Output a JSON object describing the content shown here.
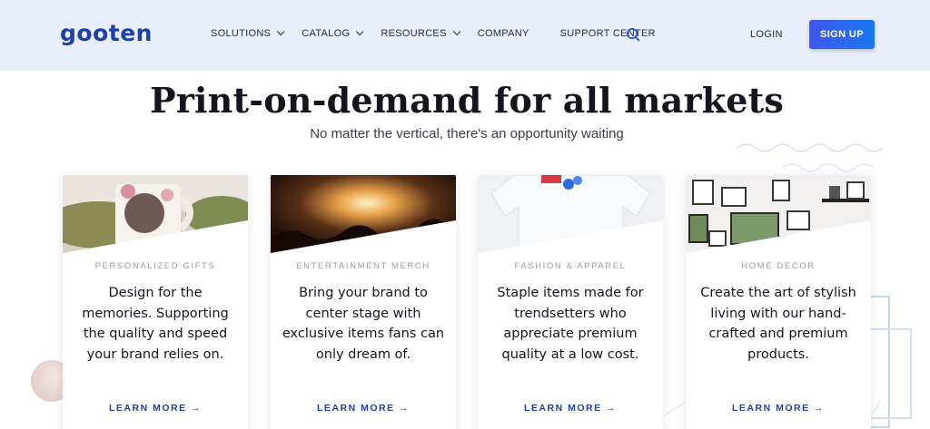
{
  "header": {
    "logo": "gooten",
    "nav": [
      {
        "label": "SOLUTIONS",
        "dropdown": true
      },
      {
        "label": "CATALOG",
        "dropdown": true
      },
      {
        "label": "RESOURCES",
        "dropdown": true
      },
      {
        "label": "COMPANY",
        "dropdown": false
      },
      {
        "label": "SUPPORT CENTER",
        "dropdown": false
      }
    ],
    "search_icon": "search-icon",
    "login": "LOGIN",
    "signup": "SIGN UP"
  },
  "hero": {
    "title": "Print-on-demand for all markets",
    "subtitle": "No matter the vertical, there's an opportunity waiting"
  },
  "cards": [
    {
      "category": "PERSONALIZED GIFTS",
      "body": "Design for the memories. Supporting the quality and speed your brand relies on.",
      "link": "LEARN MORE →"
    },
    {
      "category": "ENTERTAINMENT MERCH",
      "body": "Bring your brand to center stage with exclusive items fans can only dream of.",
      "link": "LEARN MORE →"
    },
    {
      "category": "FASHION & APPAREL",
      "body": "Staple items made for trendsetters who appreciate premium quality at a low cost.",
      "link": "LEARN MORE →"
    },
    {
      "category": "HOME DECOR",
      "body": "Create the art of stylish living with our hand-crafted and premium products.",
      "link": "LEARN MORE →"
    }
  ],
  "colors": {
    "header_bg": "#e9eefb",
    "brand": "#1d3fa6",
    "signup_gradient_start": "#3f56f0",
    "signup_gradient_end": "#1877f2"
  }
}
